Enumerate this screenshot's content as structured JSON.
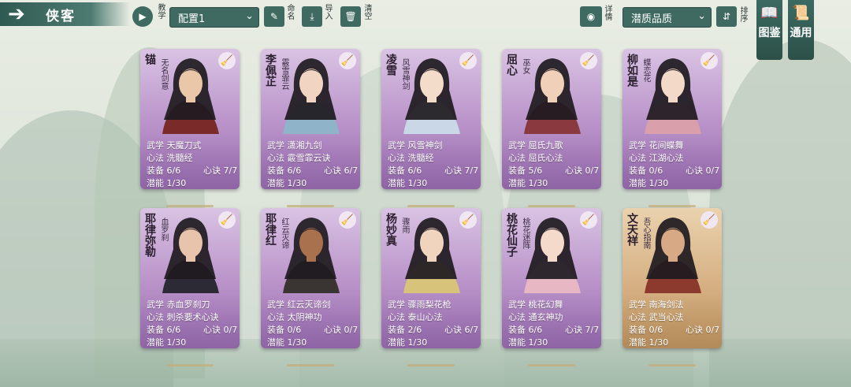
{
  "header": {
    "back_icon": "back-arrow-icon",
    "title": "侠客",
    "tutorial_label": "教学",
    "config_select": "配置1",
    "rename_label": "命名",
    "import_label": "导入",
    "clear_label": "清空",
    "detail_label": "详情",
    "quality_select": "潜质品质",
    "sort_label": "排序",
    "atlas_label": "图鉴",
    "general_label": "通用"
  },
  "labels": {
    "martial": "武学",
    "mind": "心法",
    "equip": "装备",
    "secret": "心诀",
    "potential": "潜能"
  },
  "heroes": [
    {
      "name": "锚",
      "sub": "无名剑意",
      "martial": "天魔刀式",
      "mind": "洗髓经",
      "equip": "6/6",
      "secret": "7/7",
      "potential": "1/30",
      "rarity": "purple",
      "robe": "#7b2a2a",
      "skin": "#e9c7a8"
    },
    {
      "name": "李佩芷",
      "sub": "霰雪霏云",
      "martial": "潇湘九剑",
      "mind": "霰雪霏云诀",
      "equip": "6/6",
      "secret": "6/7",
      "potential": "1/30",
      "rarity": "purple",
      "robe": "#8fb3c9",
      "skin": "#f1d5c2"
    },
    {
      "name": "凌雪",
      "sub": "风雪神剑",
      "martial": "风雪神剑",
      "mind": "洗髓经",
      "equip": "6/6",
      "secret": "7/7",
      "potential": "1/30",
      "rarity": "purple",
      "robe": "#c9d7e6",
      "skin": "#f3dcca"
    },
    {
      "name": "屈心",
      "sub": "巫女",
      "martial": "屈氏九歌",
      "mind": "屈氏心法",
      "equip": "5/6",
      "secret": "0/7",
      "potential": "1/30",
      "rarity": "purple",
      "robe": "#8a3a3f",
      "skin": "#f0d0b8"
    },
    {
      "name": "柳如是",
      "sub": "蝶恋花",
      "martial": "花间蝶舞",
      "mind": "江湖心法",
      "equip": "0/6",
      "secret": "0/7",
      "potential": "1/30",
      "rarity": "purple",
      "robe": "#d9a0ac",
      "skin": "#f3d9c8"
    },
    {
      "name": "耶律弥勒",
      "sub": "血罗刹",
      "martial": "赤血罗刹刀",
      "mind": "刺杀要术心诀",
      "equip": "6/6",
      "secret": "0/7",
      "potential": "1/30",
      "rarity": "purple",
      "robe": "#2b2a35",
      "skin": "#e8c4ad"
    },
    {
      "name": "耶律红",
      "sub": "红云灭谛",
      "martial": "红云灭谛剑",
      "mind": "太阴神功",
      "equip": "0/6",
      "secret": "0/7",
      "potential": "1/30",
      "rarity": "purple",
      "robe": "#3a3533",
      "skin": "#a9714e"
    },
    {
      "name": "杨妙真",
      "sub": "骤雨",
      "martial": "骤雨梨花枪",
      "mind": "泰山心法",
      "equip": "2/6",
      "secret": "6/7",
      "potential": "1/30",
      "rarity": "purple",
      "robe": "#d8c37a",
      "skin": "#f1d4be"
    },
    {
      "name": "桃花仙子",
      "sub": "桃花迷阵",
      "martial": "桃花幻舞",
      "mind": "通玄神功",
      "equip": "6/6",
      "secret": "7/7",
      "potential": "1/30",
      "rarity": "purple",
      "robe": "#e7b8c4",
      "skin": "#f4dacb"
    },
    {
      "name": "文天祥",
      "sub": "吾心指南",
      "martial": "南海剑法",
      "mind": "武当心法",
      "equip": "0/6",
      "secret": "0/7",
      "potential": "1/30",
      "rarity": "gold",
      "robe": "#8d3a2e",
      "skin": "#d7a985"
    }
  ]
}
